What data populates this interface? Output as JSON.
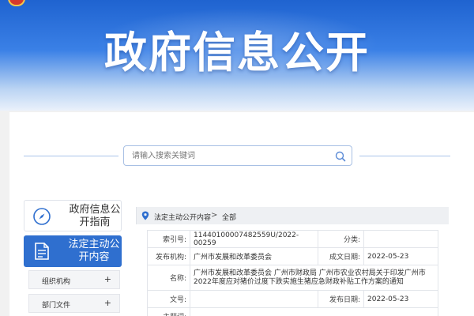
{
  "banner": {
    "title": "政府信息公开"
  },
  "search": {
    "placeholder": "请输入搜索关键词"
  },
  "nav": {
    "guide_label": "政府信息公开指南",
    "active_label": "法定主动公开内容",
    "sub_items": [
      {
        "label": "组织机构",
        "icon": "+"
      },
      {
        "label": "部门文件",
        "icon": "+"
      }
    ]
  },
  "breadcrumb": {
    "items": [
      "法定主动公开内容",
      "全部"
    ],
    "separator": ">"
  },
  "info": {
    "index_label": "索引号:",
    "index_value": "11440100007482559U/2022-00259",
    "category_label": "分类:",
    "category_value": "",
    "publisher_label": "发布机构:",
    "publisher_value": "广州市发展和改革委员会",
    "created_label": "成文日期:",
    "created_value": "2022-05-23",
    "name_label": "名称:",
    "name_value": "广州市发展和改革委员会 广州市财政局 广州市农业农村局关于印发广州市2022年度应对猪价过度下跌实施生猪应急财政补贴工作方案的通知",
    "doc_label": "文号:",
    "doc_value": "",
    "published_label": "发布日期:",
    "published_value": "2022-05-23",
    "subject_label": "主题词:"
  },
  "colors": {
    "primary": "#2f6fcf",
    "banner_top": "#1f63d0",
    "border": "#e2e5ea"
  }
}
